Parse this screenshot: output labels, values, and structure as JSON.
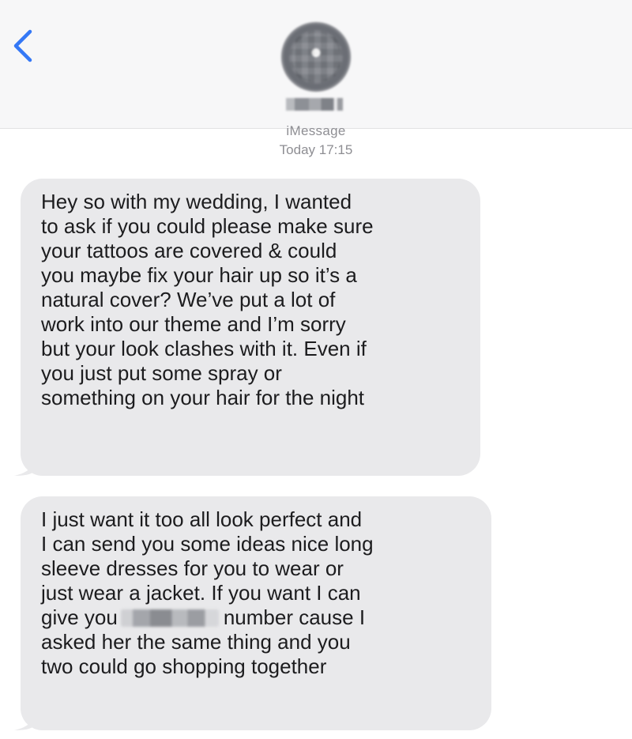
{
  "header": {
    "service": "iMessage",
    "timestamp": "Today 17:15"
  },
  "messages": [
    {
      "direction": "incoming",
      "lines": [
        "Hey so with my wedding, I wanted",
        "to ask if you could please make sure",
        "your tattoos are covered & could",
        "you maybe fix your hair up so it’s a",
        "natural cover? We’ve put a lot of",
        "work into our theme and I’m sorry",
        "but your look clashes with it. Even if",
        "you just put some spray or",
        "something on your hair for the night"
      ]
    },
    {
      "direction": "incoming",
      "lines": [
        "I just want it too all look perfect and",
        "I can send you some ideas nice long",
        "sleeve dresses for you to wear or",
        "just wear a jacket. If you want I can"
      ],
      "redacted_line": {
        "before": "give you",
        "after": "number cause I"
      },
      "lines_after": [
        "asked her the same thing and you",
        "two could go shopping together"
      ]
    }
  ],
  "colors": {
    "link_blue": "#3478f6",
    "bubble_gray": "#e9e9eb",
    "meta_gray": "#8e8e93"
  },
  "icons": {
    "back": "chevron-left-icon"
  }
}
